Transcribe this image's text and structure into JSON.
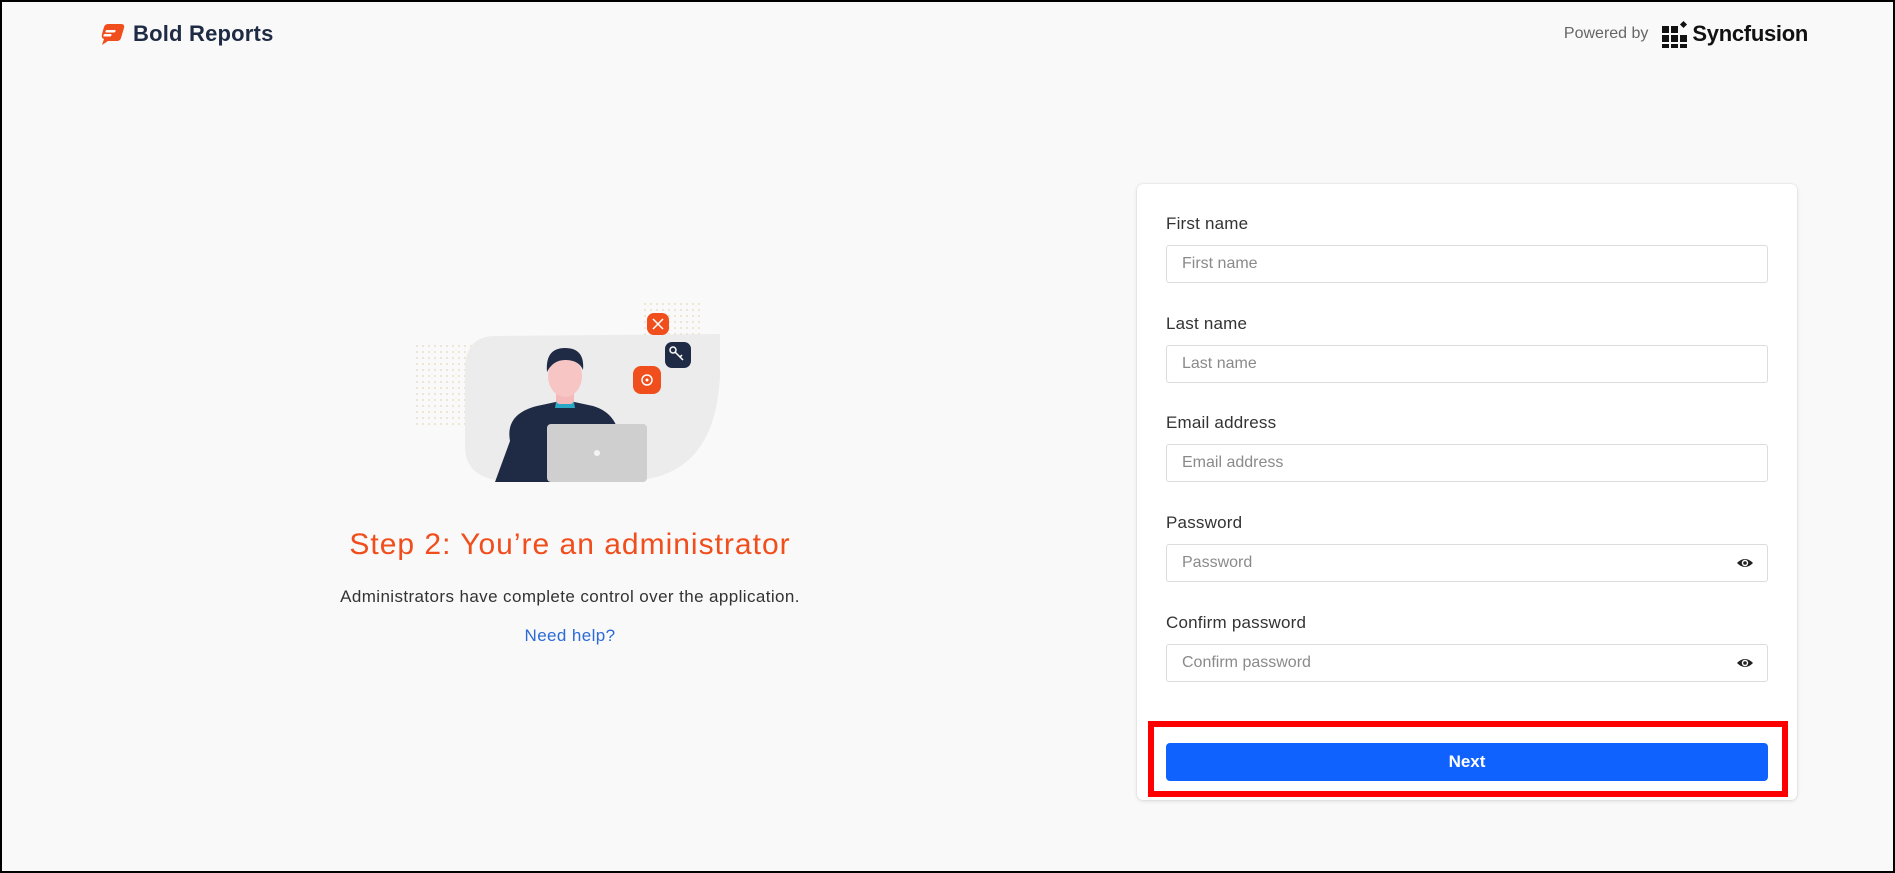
{
  "header": {
    "brand_name": "Bold Reports",
    "powered_by_label": "Powered by",
    "partner_name": "Syncfusion"
  },
  "intro": {
    "title": "Step 2: You’re an administrator",
    "description": "Administrators have complete control over the application.",
    "help_link": "Need help?"
  },
  "form": {
    "first_name": {
      "label": "First name",
      "placeholder": "First name",
      "value": ""
    },
    "last_name": {
      "label": "Last name",
      "placeholder": "Last name",
      "value": ""
    },
    "email": {
      "label": "Email address",
      "placeholder": "Email address",
      "value": ""
    },
    "password": {
      "label": "Password",
      "placeholder": "Password",
      "value": ""
    },
    "confirm_password": {
      "label": "Confirm password",
      "placeholder": "Confirm password",
      "value": ""
    },
    "next_label": "Next"
  },
  "colors": {
    "accent_orange": "#f04e1c",
    "primary_blue": "#0f62fe",
    "link_blue": "#2b6ad8",
    "highlight_red": "#ff0000",
    "navy": "#1f2a44"
  },
  "icons": {
    "brand": "bold-reports-logo-icon",
    "partner": "syncfusion-logo-icon",
    "password_toggle": "eye-icon"
  }
}
